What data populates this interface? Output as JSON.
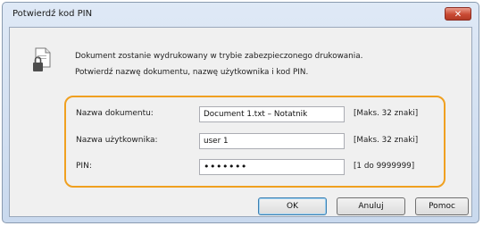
{
  "window": {
    "title": "Potwierdź kod PIN",
    "close_symbol": "✕"
  },
  "message": {
    "line1": "Dokument zostanie wydrukowany w trybie zabezpieczonego drukowania.",
    "line2": "Potwierdź nazwę dokumentu, nazwę użytkownika i kod PIN."
  },
  "fields": [
    {
      "label": "Nazwa dokumentu:",
      "value": "Document 1.txt – Notatnik",
      "hint": "[Maks. 32 znaki]"
    },
    {
      "label": "Nazwa użytkownika:",
      "value": "user 1",
      "hint": "[Maks. 32 znaki]"
    },
    {
      "label": "PIN:",
      "value": "•••••••",
      "hint": "[1 do 9999999]"
    }
  ],
  "buttons": {
    "ok": "OK",
    "cancel": "Anuluj",
    "help": "Pomoc"
  },
  "icons": {
    "message_icon": "document-lock-icon"
  },
  "colors": {
    "highlight": "#f0a020",
    "close": "#c94a34"
  }
}
